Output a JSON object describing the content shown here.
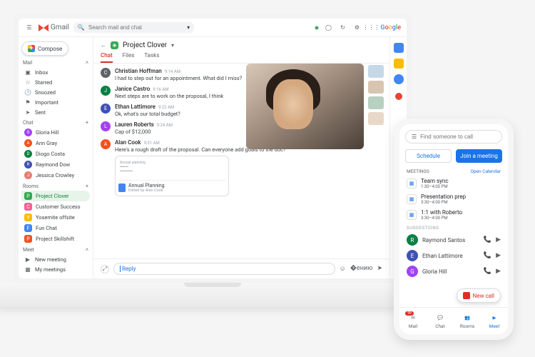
{
  "header": {
    "app_name": "Gmail",
    "search_placeholder": "Search mail and chat",
    "google_label": "Google"
  },
  "sidebar": {
    "compose_label": "Compose",
    "mail": {
      "section_label": "Mail",
      "items": [
        {
          "icon": "inbox",
          "label": "Inbox"
        },
        {
          "icon": "star",
          "label": "Starred"
        },
        {
          "icon": "clock",
          "label": "Snoozed"
        },
        {
          "icon": "flag",
          "label": "Important"
        },
        {
          "icon": "send",
          "label": "Sent"
        }
      ]
    },
    "chat": {
      "section_label": "Chat",
      "contacts": [
        {
          "name": "Gloria Hill",
          "color": "#a142f4"
        },
        {
          "name": "Ann Gray",
          "color": "#f4511e"
        },
        {
          "name": "Diogo Costa",
          "color": "#0b8043"
        },
        {
          "name": "Raymond Dow",
          "color": "#3f51b5"
        },
        {
          "name": "Jessica Crowley",
          "color": "#e67c73"
        }
      ]
    },
    "rooms": {
      "section_label": "Rooms",
      "items": [
        {
          "name": "Project Clover",
          "color": "#34a853",
          "selected": true
        },
        {
          "name": "Customer Success",
          "color": "#f06292"
        },
        {
          "name": "Yosemite offsite",
          "color": "#fbbc04"
        },
        {
          "name": "Fun Chat",
          "color": "#4285f4"
        },
        {
          "name": "Project Skillshift",
          "color": "#f4511e"
        }
      ]
    },
    "meet": {
      "section_label": "Meet",
      "items": [
        {
          "icon": "video",
          "label": "New meeting"
        },
        {
          "icon": "grid",
          "label": "My meetings"
        }
      ]
    }
  },
  "main": {
    "room_name": "Project Clover",
    "tabs": [
      "Chat",
      "Files",
      "Tasks"
    ],
    "active_tab": "Chat",
    "messages": [
      {
        "author": "Christian Hoffman",
        "time": "9:14 AM",
        "text": "I had to step out for an appointment. What did I miss?",
        "color": "#5f6368"
      },
      {
        "author": "Janice Castro",
        "time": "9:16 AM",
        "text": "Next steps are to work on the proposal, I think",
        "color": "#0b8043"
      },
      {
        "author": "Ethan Lattimore",
        "time": "9:22 AM",
        "text": "Ok, what's our total budget?",
        "color": "#3f51b5"
      },
      {
        "author": "Lauren Roberts",
        "time": "9:24 AM",
        "text": "Cap of $12,000",
        "color": "#a142f4"
      },
      {
        "author": "Alan Cook",
        "time": "9:31 AM",
        "text": "Here's a rough draft of the proposal. Can everyone add goals to the doc?",
        "color": "#f4511e"
      }
    ],
    "attachment": {
      "preview_label": "Annual planning",
      "title": "Annual Planning",
      "subtitle": "Edited by Alan Cook"
    },
    "composer_placeholder": "Reply"
  },
  "phone": {
    "search_placeholder": "Find someone to call",
    "schedule_label": "Schedule",
    "join_label": "Join a meeting",
    "meetings_label": "MEETINGS",
    "open_calendar_label": "Open Calendar",
    "meetings": [
      {
        "title": "Team sync",
        "detail": "1:30–4:00 PM"
      },
      {
        "title": "Presentation prep",
        "detail": "3:30–4:00 PM"
      },
      {
        "title": "1:1 with Roberto",
        "detail": "3:30–4:00 PM"
      }
    ],
    "suggestions_label": "SUGGESTIONS",
    "contacts": [
      {
        "name": "Raymond Santos",
        "color": "#0b8043"
      },
      {
        "name": "Ethan Lattimore",
        "color": "#3f51b5"
      },
      {
        "name": "Gloria Hill",
        "color": "#a142f4"
      }
    ],
    "fab_label": "New call",
    "bottom_nav": [
      {
        "icon": "mail",
        "label": "Mail",
        "badge": "99"
      },
      {
        "icon": "chat",
        "label": "Chat"
      },
      {
        "icon": "rooms",
        "label": "Rooms"
      },
      {
        "icon": "meet",
        "label": "Meet",
        "active": true
      }
    ]
  },
  "colors": {
    "accent_blue": "#1a73e8",
    "accent_red": "#d93025",
    "accent_green": "#34a853"
  }
}
